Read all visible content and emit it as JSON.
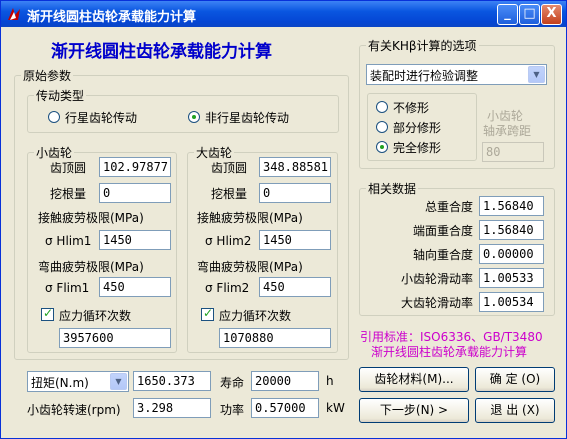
{
  "window": {
    "title": "渐开线圆柱齿轮承载能力计算",
    "minimize": "_",
    "maximize": "□",
    "close": "X"
  },
  "heading": "渐开线圆柱齿轮承载能力计算",
  "original": {
    "legend": "原始参数",
    "transmission": {
      "legend": "传动类型",
      "option1": "行星齿轮传动",
      "option2": "非行星齿轮传动",
      "selected": "非行星齿轮传动"
    },
    "pinion": {
      "legend": "小齿轮",
      "tip_label": "齿顶圆",
      "tip_value": "102.97877",
      "undercut_label": "挖根量",
      "undercut_value": "0",
      "contact_label": "接触疲劳极限(MPa)",
      "hlim_label": "σ Hlim1",
      "hlim_value": "1450",
      "bending_label": "弯曲疲劳极限(MPa)",
      "flim_label": "σ Flim1",
      "flim_value": "450",
      "cycles_label": "应力循环次数",
      "cycles_checked": true,
      "cycles_value": "3957600"
    },
    "gear": {
      "legend": "大齿轮",
      "tip_label": "齿顶圆",
      "tip_value": "348.88581",
      "undercut_label": "挖根量",
      "undercut_value": "0",
      "contact_label": "接触疲劳极限(MPa)",
      "hlim_label": "σ Hlim2",
      "hlim_value": "1450",
      "bending_label": "弯曲疲劳极限(MPa)",
      "flim_label": "σ Flim2",
      "flim_value": "450",
      "cycles_label": "应力循环次数",
      "cycles_checked": true,
      "cycles_value": "1070880"
    }
  },
  "khb": {
    "legend": "有关KHβ计算的选项",
    "select_value": "装配时进行检验调整",
    "option1": "不修形",
    "option2": "部分修形",
    "option3": "完全修形",
    "selected": "完全修形",
    "bearing_label_1": "小齿轮",
    "bearing_label_2": "轴承跨距",
    "bearing_value": "80"
  },
  "related": {
    "legend": "相关数据",
    "rows": [
      {
        "label": "总重合度",
        "value": "1.56840"
      },
      {
        "label": "端面重合度",
        "value": "1.56840"
      },
      {
        "label": "轴向重合度",
        "value": "0.00000"
      },
      {
        "label": "小齿轮滑动率",
        "value": "1.00533"
      },
      {
        "label": "大齿轮滑动率",
        "value": "1.00534"
      }
    ]
  },
  "reference": {
    "line1": "引用标准：ISO6336、GB/T3480",
    "line2": "渐开线圆柱齿轮承载能力计算"
  },
  "bottom": {
    "torque_select": "扭矩(N.m)",
    "torque_value": "1650.373",
    "life_label": "寿命",
    "life_value": "20000",
    "life_unit": "h",
    "speed_label": "小齿轮转速(rpm)",
    "speed_value": "3.298",
    "power_label": "功率",
    "power_value": "0.57000",
    "power_unit": "kW"
  },
  "buttons": {
    "material": "齿轮材料(M)...",
    "ok": "确 定 (O)",
    "next": "下一步(N) >",
    "exit": "退 出 (X)"
  }
}
